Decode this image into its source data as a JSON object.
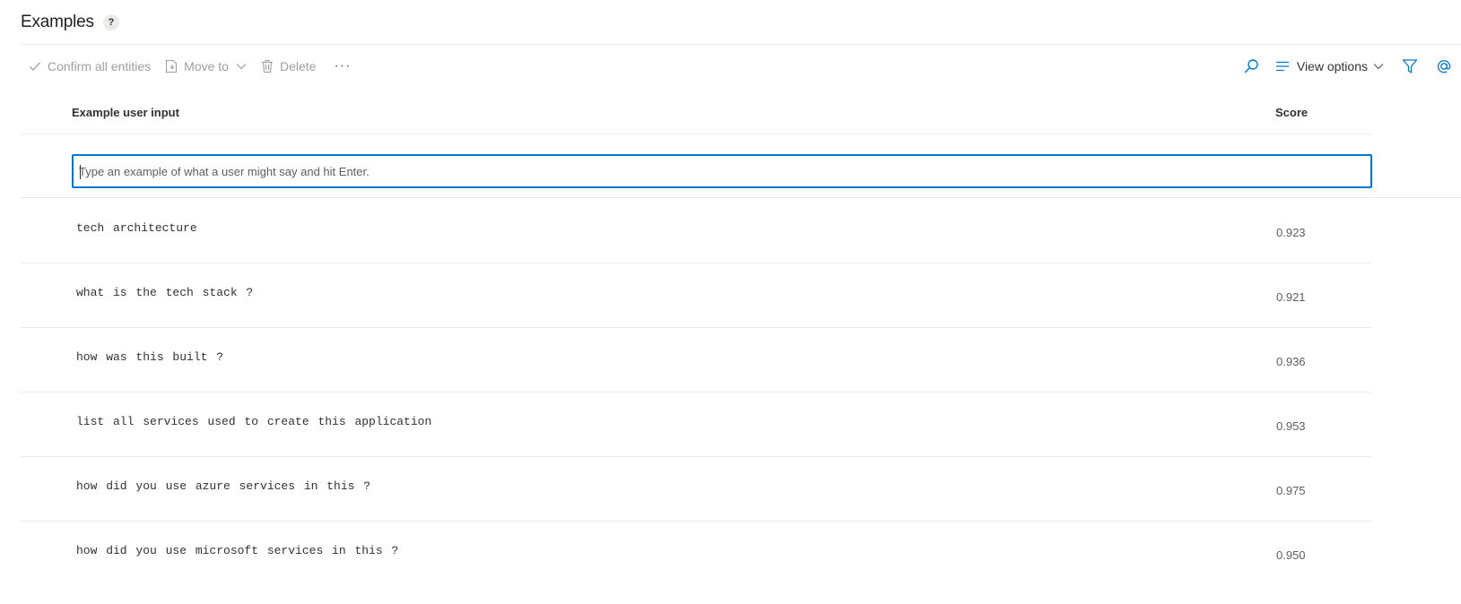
{
  "header": {
    "title": "Examples",
    "help_label": "?"
  },
  "toolbar": {
    "confirm_label": "Confirm all entities",
    "move_label": "Move to",
    "delete_label": "Delete",
    "more_label": "···",
    "view_options_label": "View options",
    "icons": [
      "check-icon",
      "move-doc-icon",
      "chevron-down-icon",
      "trash-icon",
      "search-icon",
      "lines-icon",
      "filter-icon",
      "at-icon"
    ],
    "accent_color": "#0078d4",
    "disabled_color": "#a19f9d"
  },
  "table": {
    "columns": {
      "input": "Example user input",
      "score": "Score"
    },
    "new_input": {
      "value": "",
      "placeholder": "Type an example of what a user might say and hit Enter."
    },
    "rows": [
      {
        "text": "tech architecture",
        "score": "0.923"
      },
      {
        "text": "what is the tech stack ?",
        "score": "0.921"
      },
      {
        "text": "how was this built ?",
        "score": "0.936"
      },
      {
        "text": "list all services used to create this application",
        "score": "0.953"
      },
      {
        "text": "how did you use azure services in this ?",
        "score": "0.975"
      },
      {
        "text": "how did you use microsoft services in this ?",
        "score": "0.950"
      }
    ]
  }
}
